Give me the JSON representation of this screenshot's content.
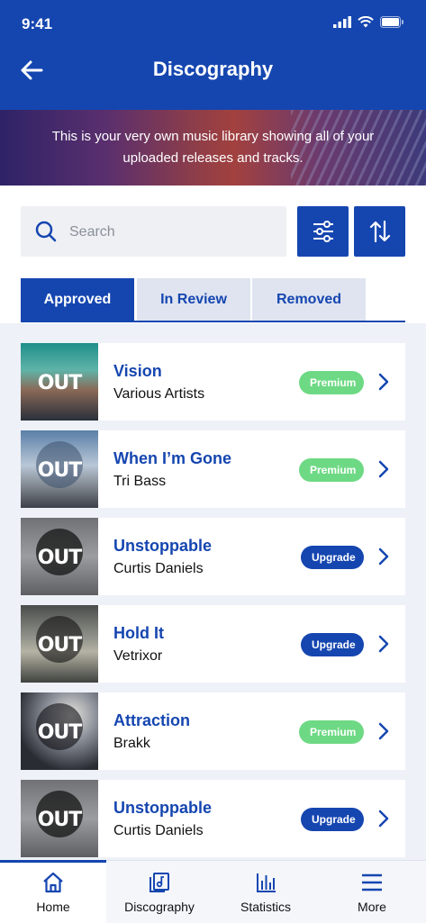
{
  "status": {
    "time": "9:41"
  },
  "header": {
    "title": "Discography"
  },
  "banner": {
    "text": "This is your very own music library showing all of your uploaded releases and tracks."
  },
  "search": {
    "placeholder": "Search",
    "value": ""
  },
  "tabs": [
    {
      "label": "Approved",
      "active": true
    },
    {
      "label": "In Review",
      "active": false
    },
    {
      "label": "Removed",
      "active": false
    }
  ],
  "cover_logo": "OUT",
  "releases": [
    {
      "title": "Vision",
      "artist": "Various Artists",
      "badge": "Premium",
      "badge_type": "premium"
    },
    {
      "title": "When I’m Gone",
      "artist": "Tri Bass",
      "badge": "Premium",
      "badge_type": "premium"
    },
    {
      "title": "Unstoppable",
      "artist": "Curtis Daniels",
      "badge": "Upgrade",
      "badge_type": "upgrade"
    },
    {
      "title": "Hold It",
      "artist": "Vetrixor",
      "badge": "Upgrade",
      "badge_type": "upgrade"
    },
    {
      "title": "Attraction",
      "artist": "Brakk",
      "badge": "Premium",
      "badge_type": "premium"
    },
    {
      "title": "Unstoppable",
      "artist": "Curtis Daniels",
      "badge": "Upgrade",
      "badge_type": "upgrade"
    }
  ],
  "nav": [
    {
      "label": "Home",
      "icon": "home-icon",
      "active": true
    },
    {
      "label": "Discography",
      "icon": "discography-icon",
      "active": false
    },
    {
      "label": "Statistics",
      "icon": "statistics-icon",
      "active": false
    },
    {
      "label": "More",
      "icon": "menu-icon",
      "active": false
    }
  ],
  "colors": {
    "primary": "#1546b0",
    "premium": "#6ed984",
    "background": "#eef1f7"
  }
}
